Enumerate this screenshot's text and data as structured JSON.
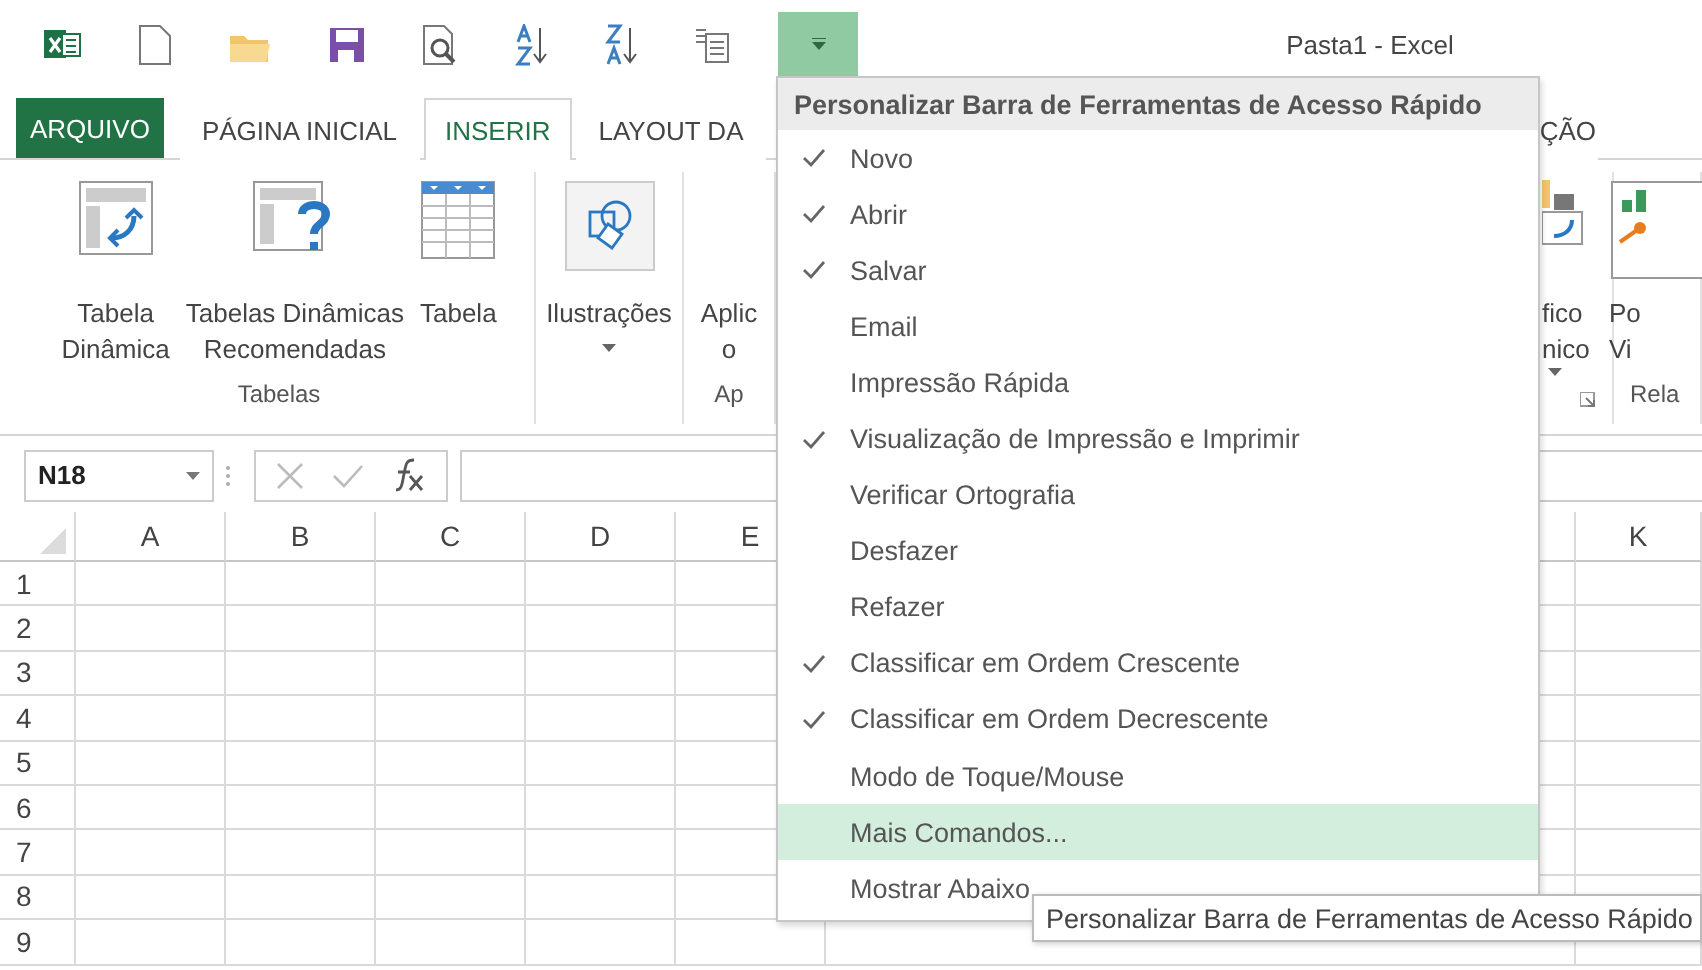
{
  "window": {
    "title": "Pasta1 - Excel"
  },
  "quick_access": {
    "customize_open": true
  },
  "tabs": [
    {
      "label": "ARQUIVO",
      "kind": "file",
      "selected": false
    },
    {
      "label": "PÁGINA INICIAL",
      "kind": "tab",
      "selected": false
    },
    {
      "label": "INSERIR",
      "kind": "tab",
      "selected": true
    },
    {
      "label": "LAYOUT DA",
      "kind": "tab",
      "selected": false
    },
    {
      "label": "ÇÃO",
      "kind": "tab",
      "selected": false
    }
  ],
  "ribbon": {
    "groups": [
      {
        "label": "Tabelas",
        "buttons": [
          {
            "lines": [
              "Tabela",
              "Dinâmica"
            ],
            "dropdown": false
          },
          {
            "lines": [
              "Tabelas Dinâmicas",
              "Recomendadas"
            ],
            "dropdown": false
          },
          {
            "lines": [
              "Tabela"
            ],
            "dropdown": false
          }
        ]
      },
      {
        "buttons": [
          {
            "lines": [
              "Ilustrações"
            ],
            "dropdown": true
          }
        ]
      },
      {
        "label": "Ap",
        "buttons": [
          {
            "lines": [
              "Aplic",
              "o"
            ],
            "dropdown": false
          }
        ]
      },
      {
        "launcher": true,
        "buttons": [
          {
            "lines": [
              "fico",
              "nico"
            ],
            "dropdown": true
          }
        ]
      },
      {
        "label": "Rela",
        "buttons": [
          {
            "lines": [
              "Po",
              "Vi"
            ],
            "dropdown": false
          }
        ]
      }
    ]
  },
  "formula_bar": {
    "name_box": "N18"
  },
  "grid": {
    "columns": [
      "A",
      "B",
      "C",
      "D",
      "E",
      "K"
    ],
    "rows": [
      "1",
      "2",
      "3",
      "4",
      "5",
      "6",
      "7",
      "8",
      "9"
    ]
  },
  "menu": {
    "title": "Personalizar Barra de Ferramentas de Acesso Rápido",
    "items": [
      {
        "label": "Novo",
        "checked": true,
        "selected": false
      },
      {
        "label": "Abrir",
        "checked": true,
        "selected": false
      },
      {
        "label": "Salvar",
        "checked": true,
        "selected": false
      },
      {
        "label": "Email",
        "checked": false,
        "selected": false
      },
      {
        "label": "Impressão Rápida",
        "checked": false,
        "selected": false
      },
      {
        "label": "Visualização de Impressão e Imprimir",
        "checked": true,
        "selected": false
      },
      {
        "label": "Verificar Ortografia",
        "checked": false,
        "selected": false
      },
      {
        "label": "Desfazer",
        "checked": false,
        "selected": false
      },
      {
        "label": "Refazer",
        "checked": false,
        "selected": false
      },
      {
        "label": "Classificar em Ordem Crescente",
        "checked": true,
        "selected": false
      },
      {
        "label": "Classificar em Ordem Decrescente",
        "checked": true,
        "selected": false
      },
      {
        "label": "Modo de Toque/Mouse",
        "checked": false,
        "selected": false
      },
      {
        "label": "Mais Comandos...",
        "checked": false,
        "selected": true
      },
      {
        "label": "Mostrar Abaixo",
        "checked": false,
        "selected": false
      }
    ]
  },
  "tooltip": {
    "text": "Personalizar Barra de Ferramentas de Acesso Rápido"
  }
}
